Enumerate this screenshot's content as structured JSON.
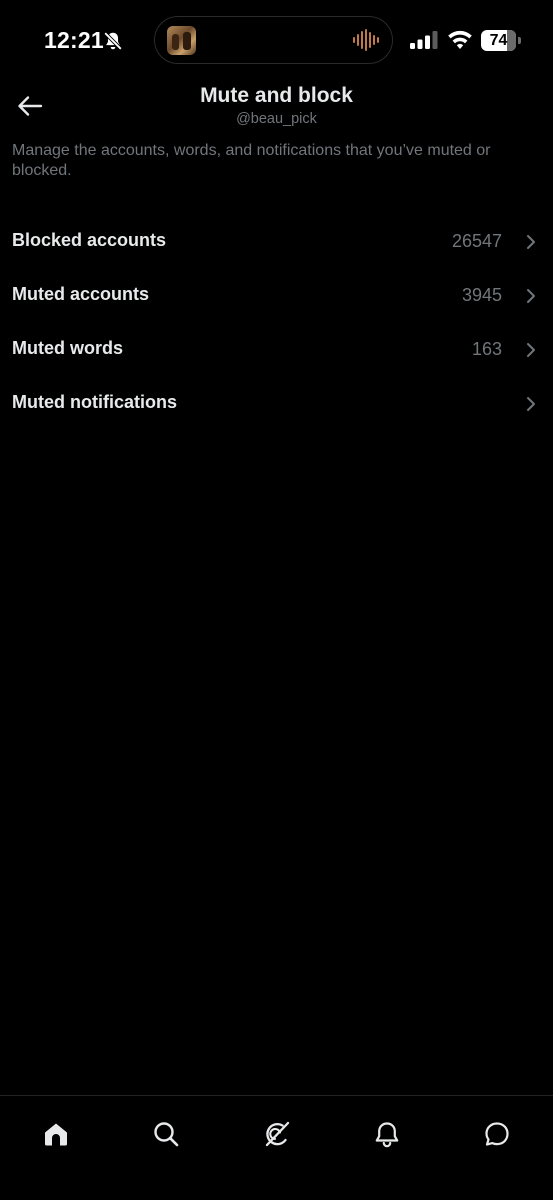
{
  "status_bar": {
    "time": "12:21",
    "battery_level": "74",
    "battery_fraction": 0.74
  },
  "header": {
    "title": "Mute and block",
    "subtitle": "@beau_pick",
    "back_icon": "arrow-left-icon"
  },
  "description": "Manage the accounts, words, and notifications that you’ve muted or blocked.",
  "settings": {
    "items": [
      {
        "label": "Blocked accounts",
        "count": "26547"
      },
      {
        "label": "Muted accounts",
        "count": "3945"
      },
      {
        "label": "Muted words",
        "count": "163"
      },
      {
        "label": "Muted notifications",
        "count": ""
      }
    ]
  },
  "bottom_nav": {
    "items": [
      {
        "icon": "home-icon"
      },
      {
        "icon": "search-icon"
      },
      {
        "icon": "grok-icon"
      },
      {
        "icon": "bell-icon"
      },
      {
        "icon": "messages-icon"
      }
    ]
  },
  "colors": {
    "background": "#000000",
    "primary_text": "#e7e9ea",
    "secondary_text": "#71767b"
  }
}
